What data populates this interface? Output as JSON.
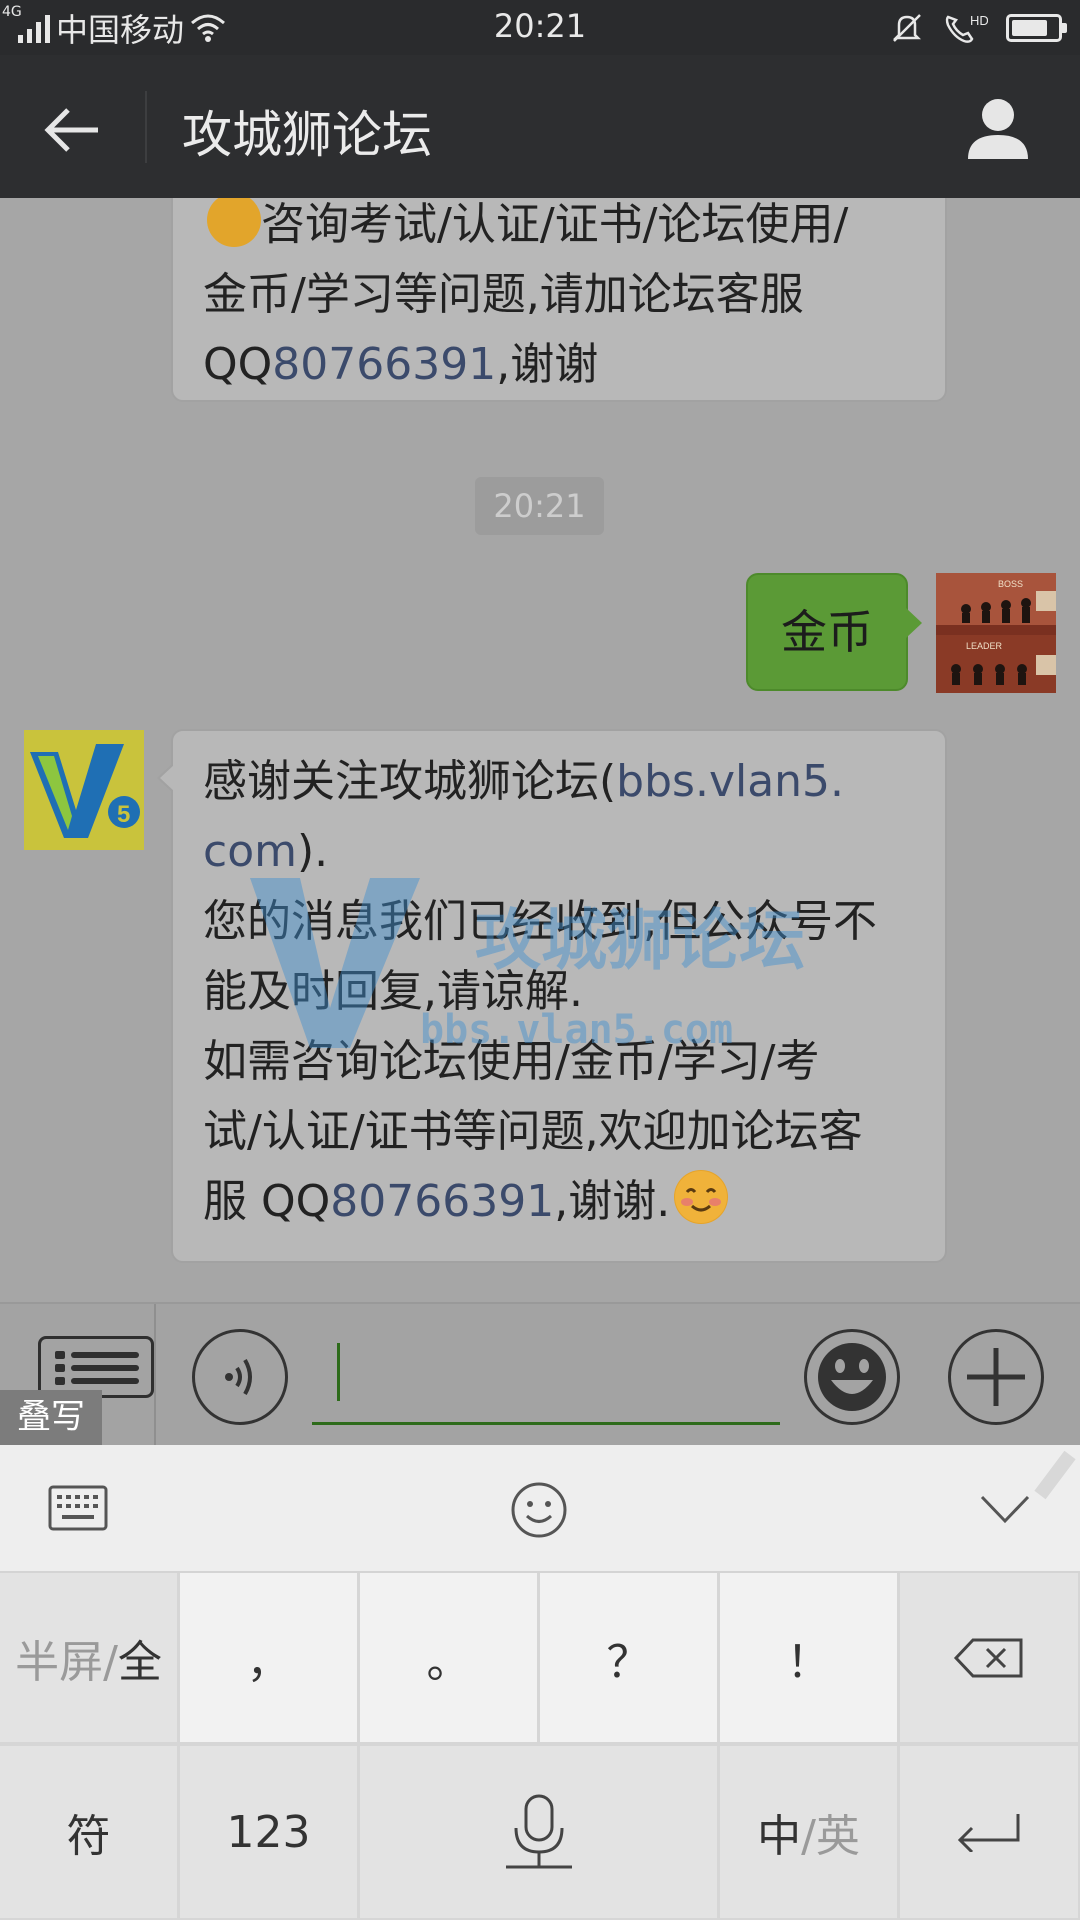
{
  "status_bar": {
    "network": "4G",
    "carrier": "中国移动",
    "time": "20:21",
    "hd": "HD",
    "battery_level": 0.8
  },
  "header": {
    "title": "攻城狮论坛"
  },
  "messages": {
    "previous": {
      "line1": "咨询考试/认证/证书/论坛使用/",
      "line2": "金币/学习等问题,请加论坛客服",
      "line3_prefix": "QQ",
      "line3_qq": "80766391",
      "line3_suffix": ",谢谢"
    },
    "timestamp": "20:21",
    "sent_text": "金币",
    "reply": {
      "l1_text": "感谢关注攻城狮论坛(",
      "l1_link": "bbs.vlan5.",
      "l2_link": "com",
      "l2_text": ").",
      "l3": "您的消息我们已经收到,但公众号不",
      "l4": "能及时回复,请谅解.",
      "l5": "如需咨询论坛使用/金币/学习/考",
      "l6": "试/认证/证书等问题,欢迎加论坛客",
      "l7_prefix": "服 QQ",
      "l7_qq": "80766391",
      "l7_suffix": ",谢谢."
    }
  },
  "watermark": {
    "logo": "V5",
    "name": "攻城狮论坛",
    "url": "bbs.vlan5.com"
  },
  "avatars": {
    "me_text_boss": "BOSS",
    "me_text_leader": "LEADER",
    "bot_logo": "V5"
  },
  "input_bar": {
    "overlay_tag": "叠写"
  },
  "keyboard": {
    "row1": {
      "half_full_a": "半屏/",
      "half_full_b": "全",
      "comma": "，",
      "period": "。",
      "question": "？",
      "exclaim": "！"
    },
    "row2": {
      "symbols": "符",
      "numbers": "123",
      "lang_a": "中",
      "lang_b": "/英"
    }
  },
  "colors": {
    "header_bg": "#2d2e30",
    "sent_bubble": "#5b9a36",
    "link": "#3b4a6b",
    "input_underline": "#2d6b1a"
  }
}
